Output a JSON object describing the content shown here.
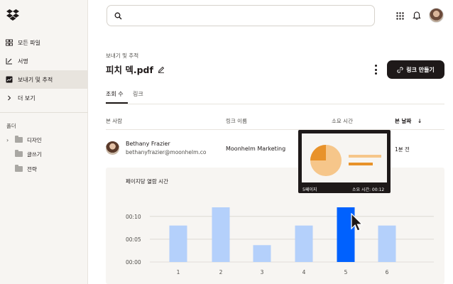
{
  "sidebar": {
    "items": [
      {
        "label": "모든 파일",
        "icon": "files-icon"
      },
      {
        "label": "서명",
        "icon": "signature-icon"
      },
      {
        "label": "보내기 및 추적",
        "icon": "send-track-icon"
      },
      {
        "label": "더 보기",
        "icon": "chevron-right-icon"
      }
    ],
    "folders_title": "폴더",
    "folders": [
      "디자인",
      "글쓰기",
      "전략"
    ]
  },
  "header": {
    "breadcrumb": "보내기 및 추적",
    "title": "피치 덱.pdf",
    "create_link_label": "링크 만들기"
  },
  "tabs": [
    "조회 수",
    "링크"
  ],
  "table": {
    "columns": [
      "본 사람",
      "링크 이름",
      "소요 시간",
      "본 날짜"
    ],
    "sort_icon": "↓",
    "rows": [
      {
        "name": "Bethany Frazier",
        "email": "bethanyfrazier@moonhelm.co",
        "link": "Moonhelm Marketing",
        "when": "1분 전"
      }
    ]
  },
  "chart_data": {
    "type": "bar",
    "title": "페이지당 열람 시간",
    "categories": [
      "1",
      "2",
      "3",
      "4",
      "5",
      "6"
    ],
    "values": [
      8,
      12,
      3.7,
      8,
      12,
      8
    ],
    "value_unit": "seconds",
    "y_ticks": [
      "00:00",
      "00:05",
      "00:10"
    ],
    "ylim": [
      0,
      12
    ],
    "highlighted_index": 4,
    "colors": {
      "bar": "#b4d0fb",
      "highlight": "#0061fe",
      "grid": "#d8d5d0"
    }
  },
  "popup": {
    "page": "5페이지",
    "time": "소요 시간: 00:12"
  },
  "colors": {
    "accent": "#0061fe",
    "dark": "#1e1919"
  }
}
